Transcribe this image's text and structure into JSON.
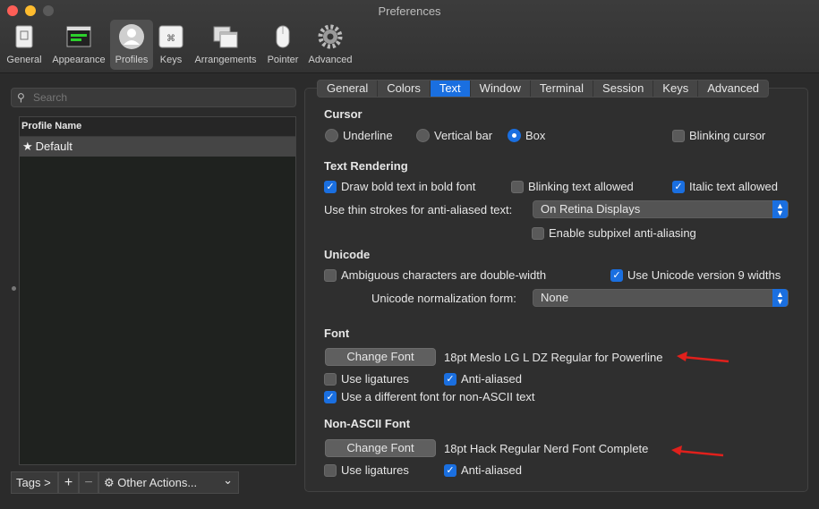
{
  "window": {
    "title": "Preferences"
  },
  "toolbar": {
    "items": [
      {
        "label": "General",
        "icon": "general-icon"
      },
      {
        "label": "Appearance",
        "icon": "appearance-icon"
      },
      {
        "label": "Profiles",
        "icon": "profiles-icon",
        "active": true
      },
      {
        "label": "Keys",
        "icon": "keys-icon"
      },
      {
        "label": "Arrangements",
        "icon": "arrangements-icon"
      },
      {
        "label": "Pointer",
        "icon": "mouse-icon"
      },
      {
        "label": "Advanced",
        "icon": "gear-icon"
      }
    ]
  },
  "sidebar": {
    "search_placeholder": "Search",
    "list_header": "Profile Name",
    "profiles": [
      {
        "name": "Default",
        "star": "★"
      }
    ],
    "tags_label": "Tags >",
    "add_label": "+",
    "remove_label": "−",
    "other_actions_label": "Other Actions...",
    "gear_glyph": "⚙",
    "dropdown_glyph": "⌄"
  },
  "tabs": {
    "items": [
      "General",
      "Colors",
      "Text",
      "Window",
      "Terminal",
      "Session",
      "Keys",
      "Advanced"
    ],
    "active": "Text"
  },
  "cursor": {
    "title": "Cursor",
    "underline": "Underline",
    "vertical_bar": "Vertical bar",
    "box": "Box",
    "blinking": "Blinking cursor",
    "selected": "Box",
    "blinking_checked": false
  },
  "text_rendering": {
    "title": "Text Rendering",
    "bold": {
      "label": "Draw bold text in bold font",
      "checked": true
    },
    "blinking": {
      "label": "Blinking text allowed",
      "checked": false
    },
    "italic": {
      "label": "Italic text allowed",
      "checked": true
    },
    "thin_strokes_label": "Use thin strokes for anti-aliased text:",
    "thin_strokes_value": "On Retina Displays",
    "subpixel": {
      "label": "Enable subpixel anti-aliasing",
      "checked": false
    }
  },
  "unicode": {
    "title": "Unicode",
    "ambiguous": {
      "label": "Ambiguous characters are double-width",
      "checked": false
    },
    "version9": {
      "label": "Use Unicode version 9 widths",
      "checked": true
    },
    "normalization_label": "Unicode normalization form:",
    "normalization_value": "None"
  },
  "font": {
    "title": "Font",
    "button": "Change Font",
    "value": "18pt Meslo LG L DZ Regular for Powerline",
    "ligatures": {
      "label": "Use ligatures",
      "checked": false
    },
    "antialiased": {
      "label": "Anti-aliased",
      "checked": true
    },
    "non_ascii": {
      "label": "Use a different font for non-ASCII text",
      "checked": true
    }
  },
  "non_ascii_font": {
    "title": "Non-ASCII Font",
    "button": "Change Font",
    "value": "18pt Hack Regular Nerd Font Complete",
    "ligatures": {
      "label": "Use ligatures",
      "checked": false
    },
    "antialiased": {
      "label": "Anti-aliased",
      "checked": true
    }
  },
  "colors": {
    "accent": "#1a6fe0",
    "annotation_arrow": "#e0201c"
  }
}
